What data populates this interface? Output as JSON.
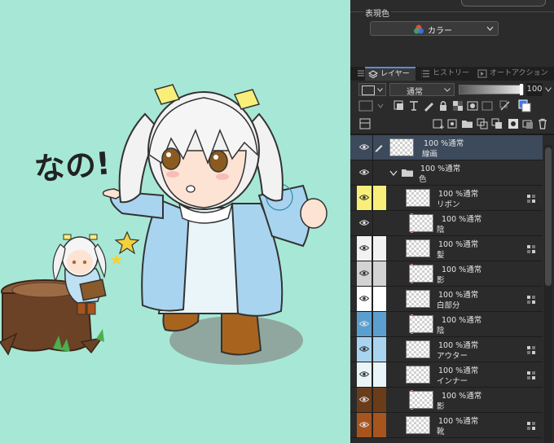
{
  "canvas": {
    "background": "#a6e8d5",
    "caption": "なの!"
  },
  "color_panel": {
    "section_label": "表現色",
    "select_value": "カラー"
  },
  "layer_panel": {
    "tabs": [
      {
        "label": "レイヤー",
        "active": true
      },
      {
        "label": "ヒストリー",
        "active": false
      },
      {
        "label": "オートアクション",
        "active": false
      }
    ],
    "blend_mode": "通常",
    "opacity_value": "100",
    "layers": [
      {
        "name": "線画",
        "opacity": "100 %",
        "mode": "通常",
        "type": "raster",
        "chip1": "",
        "chip2": "",
        "selected": true,
        "clip": false,
        "ref": false,
        "indent": 0
      },
      {
        "name": "色",
        "opacity": "100 %",
        "mode": "通常",
        "type": "folder",
        "chip1": "",
        "chip2": "",
        "selected": false,
        "clip": false,
        "ref": false,
        "indent": 0
      },
      {
        "name": "リボン",
        "opacity": "100 %",
        "mode": "通常",
        "type": "raster",
        "chip1": "#f8ef7a",
        "chip2": "#f8ef7a",
        "selected": false,
        "clip": false,
        "ref": true,
        "indent": 1
      },
      {
        "name": "陰",
        "opacity": "100 %",
        "mode": "通常",
        "type": "raster",
        "chip1": "",
        "chip2": "",
        "selected": false,
        "clip": true,
        "ref": false,
        "indent": 1
      },
      {
        "name": "髪",
        "opacity": "100 %",
        "mode": "通常",
        "type": "raster",
        "chip1": "#f2f2f2",
        "chip2": "#f2f2f2",
        "selected": false,
        "clip": false,
        "ref": true,
        "indent": 1
      },
      {
        "name": "影",
        "opacity": "100 %",
        "mode": "通常",
        "type": "raster",
        "chip1": "#d3d3d3",
        "chip2": "#d3d3d3",
        "selected": false,
        "clip": true,
        "ref": false,
        "indent": 1
      },
      {
        "name": "白部分",
        "opacity": "100 %",
        "mode": "通常",
        "type": "raster",
        "chip1": "#ffffff",
        "chip2": "#ffffff",
        "selected": false,
        "clip": false,
        "ref": true,
        "indent": 1
      },
      {
        "name": "陰",
        "opacity": "100 %",
        "mode": "通常",
        "type": "raster",
        "chip1": "#5b9fcf",
        "chip2": "#5b9fcf",
        "selected": false,
        "clip": true,
        "ref": false,
        "indent": 1
      },
      {
        "name": "アウター",
        "opacity": "100 %",
        "mode": "通常",
        "type": "raster",
        "chip1": "#a8d4f0",
        "chip2": "#a8d4f0",
        "selected": false,
        "clip": false,
        "ref": true,
        "indent": 1
      },
      {
        "name": "インナー",
        "opacity": "100 %",
        "mode": "通常",
        "type": "raster",
        "chip1": "#e9f5f8",
        "chip2": "#e9f5f8",
        "selected": false,
        "clip": false,
        "ref": true,
        "indent": 1
      },
      {
        "name": "影",
        "opacity": "100 %",
        "mode": "通常",
        "type": "raster",
        "chip1": "#6b3c1a",
        "chip2": "#6b3c1a",
        "selected": false,
        "clip": true,
        "ref": false,
        "indent": 1
      },
      {
        "name": "靴",
        "opacity": "100 %",
        "mode": "通常",
        "type": "raster",
        "chip1": "#a8541e",
        "chip2": "#a8541e",
        "selected": false,
        "clip": false,
        "ref": true,
        "indent": 1
      }
    ]
  }
}
